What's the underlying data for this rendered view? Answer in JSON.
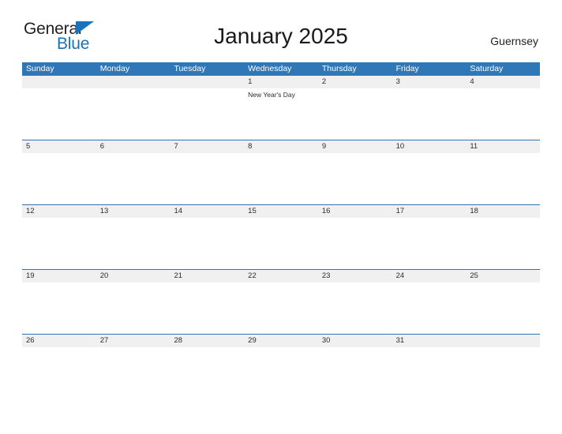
{
  "brand": {
    "name_part1": "General",
    "name_part2": "Blue",
    "flag_icon": "triangle-flag-icon",
    "accent_color": "#1b72b8"
  },
  "header": {
    "title": "January 2025",
    "locale": "Guernsey"
  },
  "calendar": {
    "header_bg": "#3077b8",
    "row_band_bg": "#f0f0f0",
    "row_divider_color": "#2e74b5",
    "weekdays": [
      "Sunday",
      "Monday",
      "Tuesday",
      "Wednesday",
      "Thursday",
      "Friday",
      "Saturday"
    ],
    "weeks": [
      {
        "days": [
          {
            "num": "",
            "events": []
          },
          {
            "num": "",
            "events": []
          },
          {
            "num": "",
            "events": []
          },
          {
            "num": "1",
            "events": [
              "New Year's Day"
            ]
          },
          {
            "num": "2",
            "events": []
          },
          {
            "num": "3",
            "events": []
          },
          {
            "num": "4",
            "events": []
          }
        ]
      },
      {
        "days": [
          {
            "num": "5",
            "events": []
          },
          {
            "num": "6",
            "events": []
          },
          {
            "num": "7",
            "events": []
          },
          {
            "num": "8",
            "events": []
          },
          {
            "num": "9",
            "events": []
          },
          {
            "num": "10",
            "events": []
          },
          {
            "num": "11",
            "events": []
          }
        ]
      },
      {
        "days": [
          {
            "num": "12",
            "events": []
          },
          {
            "num": "13",
            "events": []
          },
          {
            "num": "14",
            "events": []
          },
          {
            "num": "15",
            "events": []
          },
          {
            "num": "16",
            "events": []
          },
          {
            "num": "17",
            "events": []
          },
          {
            "num": "18",
            "events": []
          }
        ]
      },
      {
        "days": [
          {
            "num": "19",
            "events": []
          },
          {
            "num": "20",
            "events": []
          },
          {
            "num": "21",
            "events": []
          },
          {
            "num": "22",
            "events": []
          },
          {
            "num": "23",
            "events": []
          },
          {
            "num": "24",
            "events": []
          },
          {
            "num": "25",
            "events": []
          }
        ]
      },
      {
        "days": [
          {
            "num": "26",
            "events": []
          },
          {
            "num": "27",
            "events": []
          },
          {
            "num": "28",
            "events": []
          },
          {
            "num": "29",
            "events": []
          },
          {
            "num": "30",
            "events": []
          },
          {
            "num": "31",
            "events": []
          },
          {
            "num": "",
            "events": []
          }
        ]
      }
    ]
  }
}
